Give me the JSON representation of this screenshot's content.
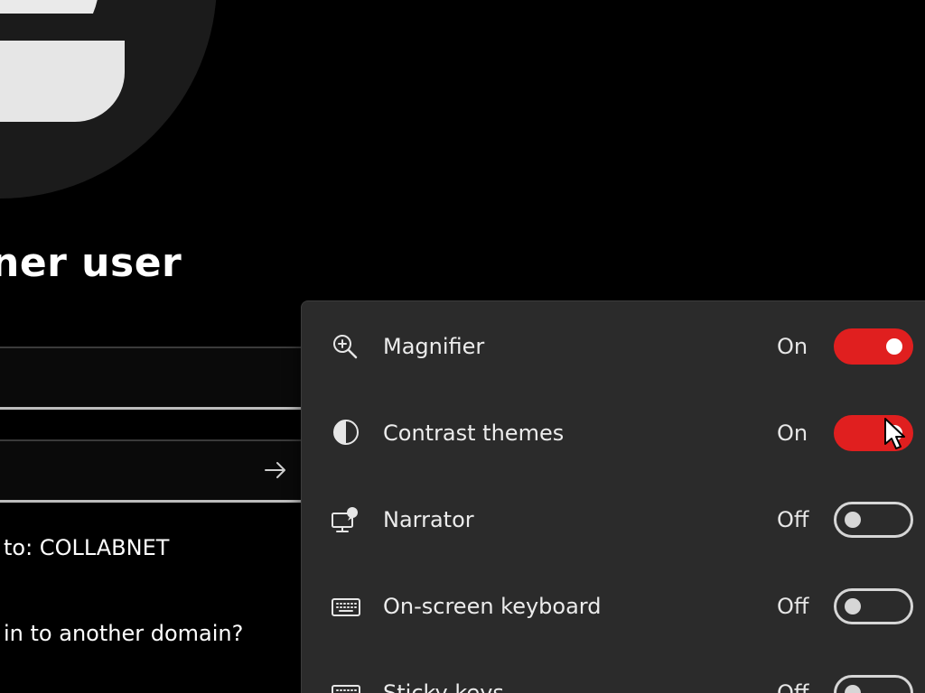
{
  "signin": {
    "title": "ner user",
    "username_value": "",
    "password_value": "",
    "signin_to": "to: COLLABNET",
    "other_domain_link": "in to another domain?"
  },
  "accessibility": {
    "items": [
      {
        "icon": "magnifier-icon",
        "label": "Magnifier",
        "state": "On",
        "enabled": true
      },
      {
        "icon": "contrast-themes-icon",
        "label": "Contrast themes",
        "state": "On",
        "enabled": true
      },
      {
        "icon": "narrator-icon",
        "label": "Narrator",
        "state": "Off",
        "enabled": false
      },
      {
        "icon": "keyboard-icon",
        "label": "On-screen keyboard",
        "state": "Off",
        "enabled": false
      },
      {
        "icon": "sticky-keys-icon",
        "label": "Sticky keys",
        "state": "Off",
        "enabled": false
      }
    ]
  },
  "colors": {
    "background": "#000000",
    "flyout_background": "#2b2b2b",
    "toggle_on": "#e01f1f",
    "toggle_off_border": "#d6d6d6"
  }
}
